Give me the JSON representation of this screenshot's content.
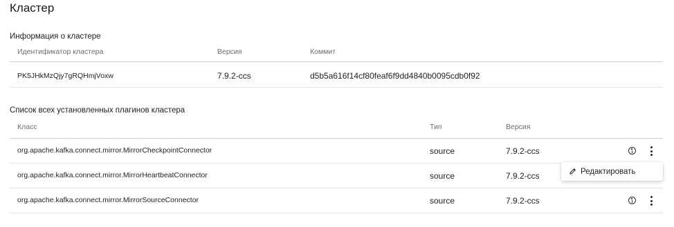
{
  "page": {
    "title": "Кластер"
  },
  "cluster_info": {
    "title": "Информация о кластере",
    "headers": {
      "id": "Идентификатор кластера",
      "version": "Версия",
      "commit": "Коммит"
    },
    "row": {
      "id": "PK5JHkMzQjy7gRQHmjVoxw",
      "version": "7.9.2-ccs",
      "commit": "d5b5a616f14cf80feaf6f9dd4840b0095cdb0f92"
    }
  },
  "plugins": {
    "title": "Список всех установленных плагинов кластера",
    "headers": {
      "class": "Класс",
      "type": "Тип",
      "version": "Версия"
    },
    "rows": [
      {
        "class": "org.apache.kafka.connect.mirror.MirrorCheckpointConnector",
        "type": "source",
        "version": "7.9.2-ccs"
      },
      {
        "class": "org.apache.kafka.connect.mirror.MirrorHeartbeatConnector",
        "type": "source",
        "version": "7.9.2-ccs"
      },
      {
        "class": "org.apache.kafka.connect.mirror.MirrorSourceConnector",
        "type": "source",
        "version": "7.9.2-ccs"
      }
    ]
  },
  "context_menu": {
    "items": [
      {
        "label": "Редактировать",
        "icon": "pencil-icon"
      }
    ]
  },
  "icons": {
    "info": "info-icon",
    "more": "more-vertical-icon"
  }
}
